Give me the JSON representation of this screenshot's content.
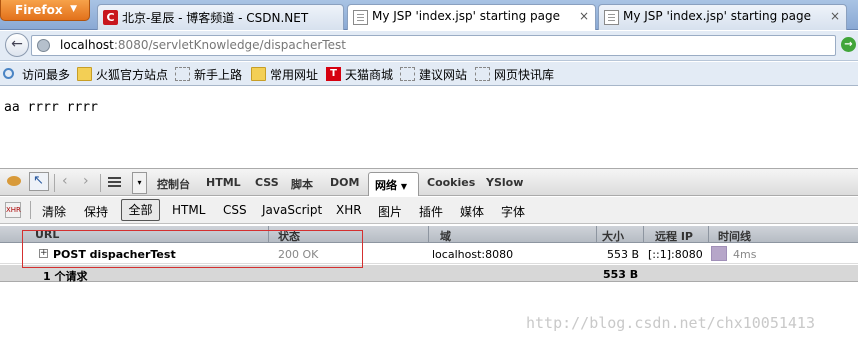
{
  "browser": {
    "menu_button": "Firefox",
    "menu_arrow": "▼",
    "tabs": [
      {
        "title": "北京-星辰 - 博客频道 - CSDN.NET",
        "icon": "csdn-logo-icon",
        "icon_glyph": "C"
      },
      {
        "title": "My JSP 'index.jsp' starting page",
        "icon": "page-icon"
      },
      {
        "title": "My JSP 'index.jsp' starting page",
        "icon": "page-icon"
      }
    ],
    "tab_close": "×",
    "back_glyph": "←",
    "url_host": "localhost",
    "url_path": ":8080/servletKnowledge/dispacherTest",
    "go_glyph": "→"
  },
  "bookmarks": [
    {
      "label": "访问最多",
      "icon": "search-icon"
    },
    {
      "label": "火狐官方站点",
      "icon": "folder-icon"
    },
    {
      "label": "新手上路",
      "icon": "dotted-page-icon"
    },
    {
      "label": "常用网址",
      "icon": "folder-icon"
    },
    {
      "label": "天猫商城",
      "icon": "tmall-icon",
      "icon_glyph": "T"
    },
    {
      "label": "建议网站",
      "icon": "dotted-page-icon"
    },
    {
      "label": "网页快讯库",
      "icon": "dotted-page-icon"
    }
  ],
  "page": {
    "text": "aa rrrr rrrr"
  },
  "firebug": {
    "nav_back": "‹",
    "nav_forward": "›",
    "dropdown_glyph": "▾",
    "tabs": [
      "控制台",
      "HTML",
      "CSS",
      "脚本",
      "DOM",
      "网络",
      "Cookies",
      "YSlow"
    ],
    "active_tab": "网络",
    "active_tab_arrow": "▼",
    "xhr_icon_text": "XHR",
    "filters": {
      "clear": "清除",
      "persist": "保持",
      "all": "全部",
      "html": "HTML",
      "css": "CSS",
      "js": "JavaScript",
      "xhr": "XHR",
      "images": "图片",
      "plugins": "插件",
      "media": "媒体",
      "fonts": "字体"
    },
    "net": {
      "columns": [
        "URL",
        "状态",
        "域",
        "大小",
        "远程 IP",
        "时间线"
      ],
      "rows": [
        {
          "expand": "+",
          "url": "POST dispacherTest",
          "status": "200 OK",
          "domain": "localhost:8080",
          "size": "553 B",
          "remote_ip": "[::1]:8080",
          "time": "4ms"
        }
      ],
      "summary": {
        "count": "1 个请求",
        "total_size": "553 B"
      }
    }
  },
  "watermark": "http://blog.csdn.net/chx10051413",
  "colors": {
    "highlight_box": "#d43030",
    "firefox_button": "#e2711b",
    "timeline_bar": "#b6a6c9"
  }
}
